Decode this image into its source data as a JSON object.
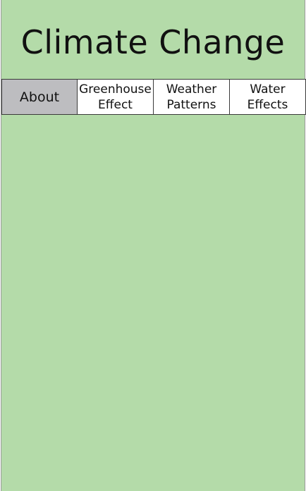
{
  "page": {
    "title": "Climate Change"
  },
  "nav": {
    "tabs": [
      {
        "label": "About",
        "active": true
      },
      {
        "label": "Greenhouse\nEffect",
        "active": false
      },
      {
        "label": "Weather\nPatterns",
        "active": false
      },
      {
        "label": "Water\nEffects",
        "active": false
      }
    ]
  },
  "colors": {
    "background": "#b4dba9",
    "tab_background": "#ffffff",
    "active_tab_background": "#bdbdc0"
  }
}
